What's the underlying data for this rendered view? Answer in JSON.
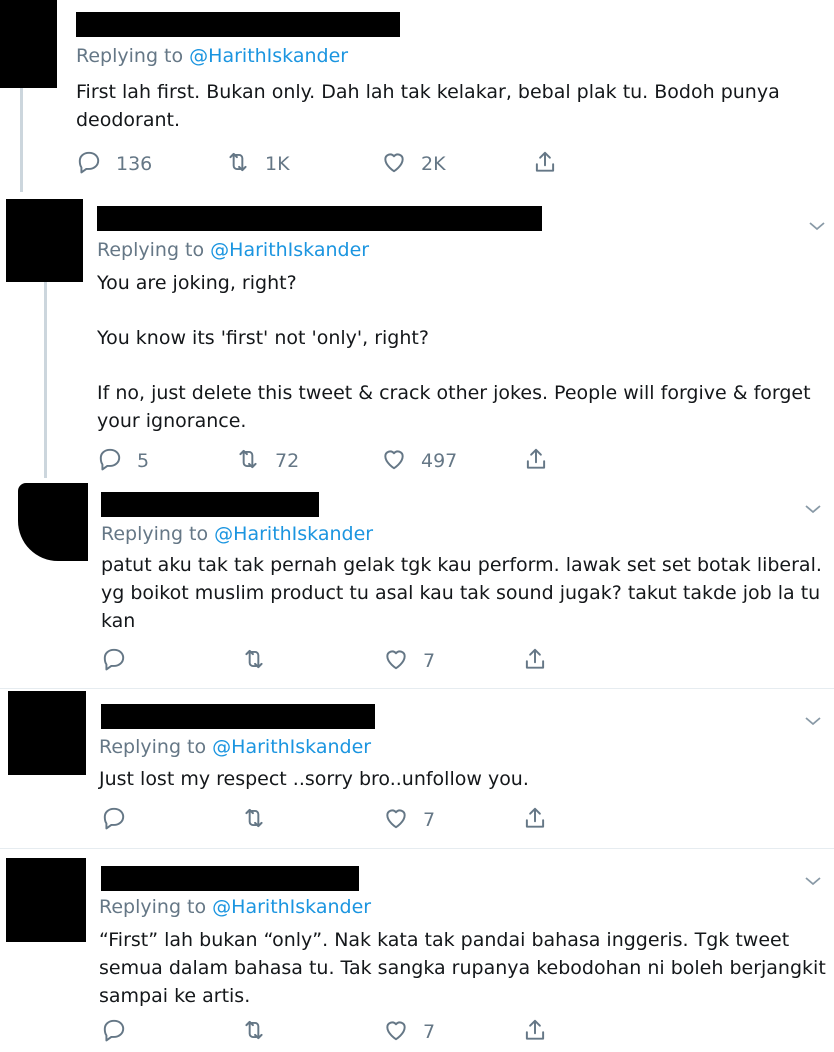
{
  "replies": [
    {
      "replying_label": "Replying to",
      "handle": "@HarithIskander",
      "text": [
        "First lah first. Bukan only. Dah lah tak kelakar, bebal plak tu. Bodoh punya",
        "deodorant."
      ],
      "reply_count": "136",
      "retweet_count": "1K",
      "like_count": "2K"
    },
    {
      "replying_label": "Replying to",
      "handle": "@HarithIskander",
      "text": [
        "You are joking, right?",
        "You know its 'first' not 'only', right?",
        "If no, just delete this tweet & crack other jokes. People will forgive & forget",
        "your ignorance."
      ],
      "reply_count": "5",
      "retweet_count": "72",
      "like_count": "497"
    },
    {
      "replying_label": "Replying to",
      "handle": "@HarithIskander",
      "text": [
        "patut aku tak tak pernah gelak tgk kau perform. lawak set set botak liberal.",
        "yg boikot muslim product tu asal kau tak sound jugak? takut takde job la tu",
        "kan"
      ],
      "reply_count": "",
      "retweet_count": "",
      "like_count": "7"
    },
    {
      "replying_label": "Replying to",
      "handle": "@HarithIskander",
      "text": [
        "Just lost my respect ..sorry bro..unfollow you."
      ],
      "reply_count": "",
      "retweet_count": "",
      "like_count": "7"
    },
    {
      "replying_label": "Replying to",
      "handle": "@HarithIskander",
      "text": [
        "“First” lah bukan “only”. Nak kata tak pandai bahasa inggeris. Tgk tweet",
        "semua dalam bahasa tu. Tak sangka rupanya kebodohan ni boleh berjangkit",
        "sampai ke artis."
      ],
      "reply_count": "",
      "retweet_count": "",
      "like_count": "7"
    }
  ],
  "icons": {
    "reply": "reply-icon",
    "retweet": "retweet-icon",
    "like": "heart-icon",
    "share": "share-icon",
    "more": "chevron-down-icon"
  },
  "colors": {
    "handle": "#1b95e0",
    "secondary_text": "#657786",
    "thread_line": "#ccd6dd",
    "redaction": "#000000"
  }
}
